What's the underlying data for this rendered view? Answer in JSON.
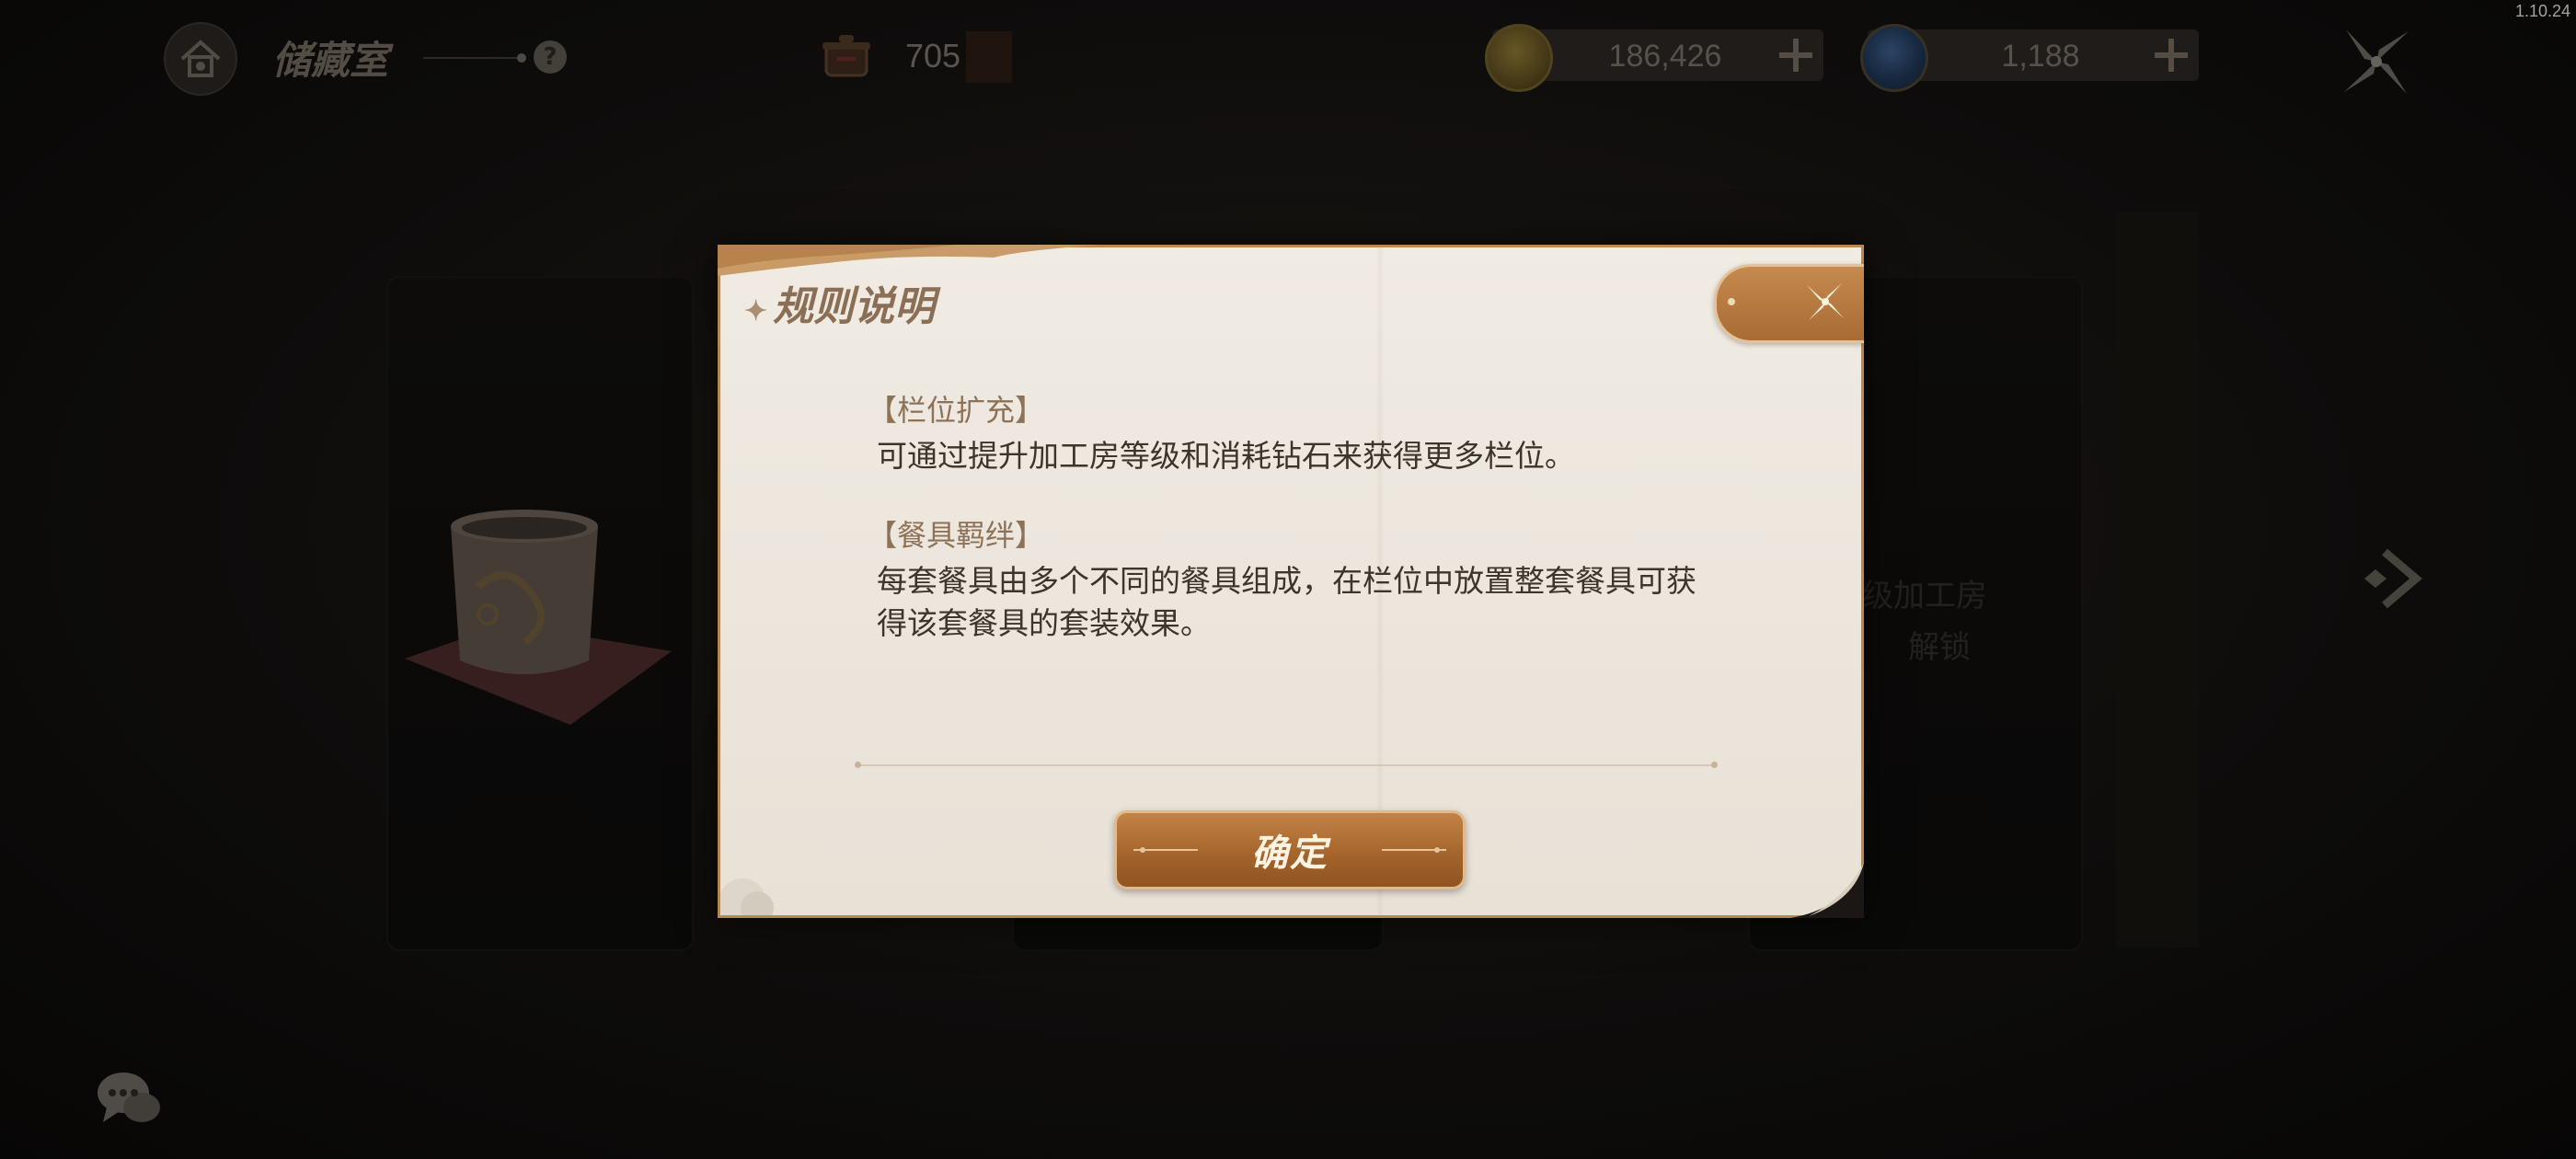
{
  "version": "1.10.24",
  "topbar": {
    "home_icon": "home-icon",
    "title": "储藏室",
    "help_icon": "help-icon",
    "tickets_count": "705",
    "currencies": [
      {
        "name": "gold-coin",
        "amount": "186,426"
      },
      {
        "name": "blue-gem",
        "amount": "1,188"
      }
    ],
    "settings_icon": "pinwheel-icon"
  },
  "background": {
    "faded_text_line1": "级加工房",
    "faded_text_line2": "解锁"
  },
  "dialog": {
    "title": "规则说明",
    "sections": [
      {
        "heading": "【栏位扩充】",
        "body": "可通过提升加工房等级和消耗钻石来获得更多栏位。"
      },
      {
        "heading": "【餐具羁绊】",
        "body": "每套餐具由多个不同的餐具组成，在栏位中放置整套餐具可获得该套餐具的套装效果。"
      }
    ],
    "confirm_label": "确定",
    "close_icon": "close-icon"
  },
  "colors": {
    "accent": "#a96b34",
    "dialog_bg": "#ece6dd",
    "heading": "#8e7257",
    "body_text": "#3d342b"
  }
}
